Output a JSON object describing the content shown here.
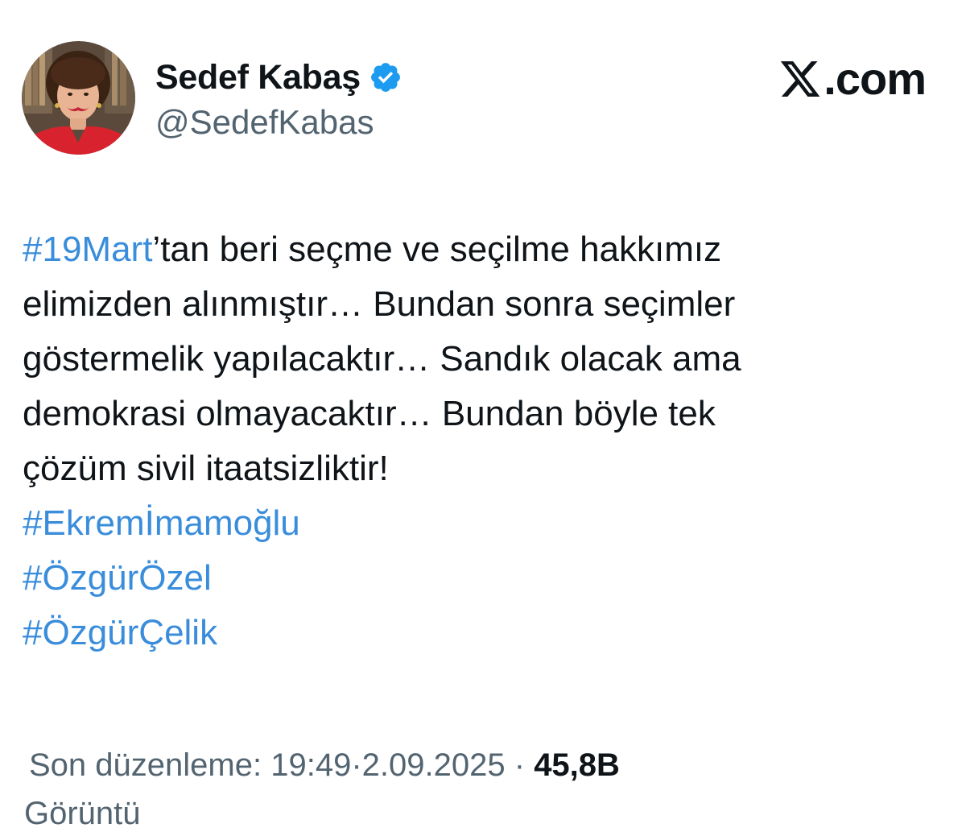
{
  "author": {
    "display_name": "Sedef Kabaş",
    "handle": "@SedefKabas",
    "avatar_icon": "profile-photo",
    "verified_icon": "verified-badge-icon",
    "verified_color": "#1d9bf0"
  },
  "brand": {
    "logo_icon": "x-logo-icon",
    "domain": ".com"
  },
  "tweet": {
    "lines": [
      {
        "hashtag": "#19Mart",
        "rest": "’tan beri seçme ve seçilme hakkımız"
      },
      {
        "text": "elimizden alınmıştır… Bundan sonra seçimler"
      },
      {
        "text": "göstermelik yapılacaktır… Sandık olacak ama"
      },
      {
        "text": "demokrasi olmayacaktır… Bundan böyle tek"
      },
      {
        "text": "çözüm sivil itaatsizliktir!"
      }
    ],
    "hashtags": [
      "#Ekremİmamoğlu",
      "#ÖzgürÖzel",
      "#ÖzgürÇelik"
    ],
    "hashtag_color": "#3a8ddb"
  },
  "meta": {
    "edited_label": "Son düzenleme:",
    "time": "19:49",
    "separator": "·",
    "date": "2.09.2025",
    "views_count": "45,8B",
    "views_label_partial": "Görüntü"
  }
}
